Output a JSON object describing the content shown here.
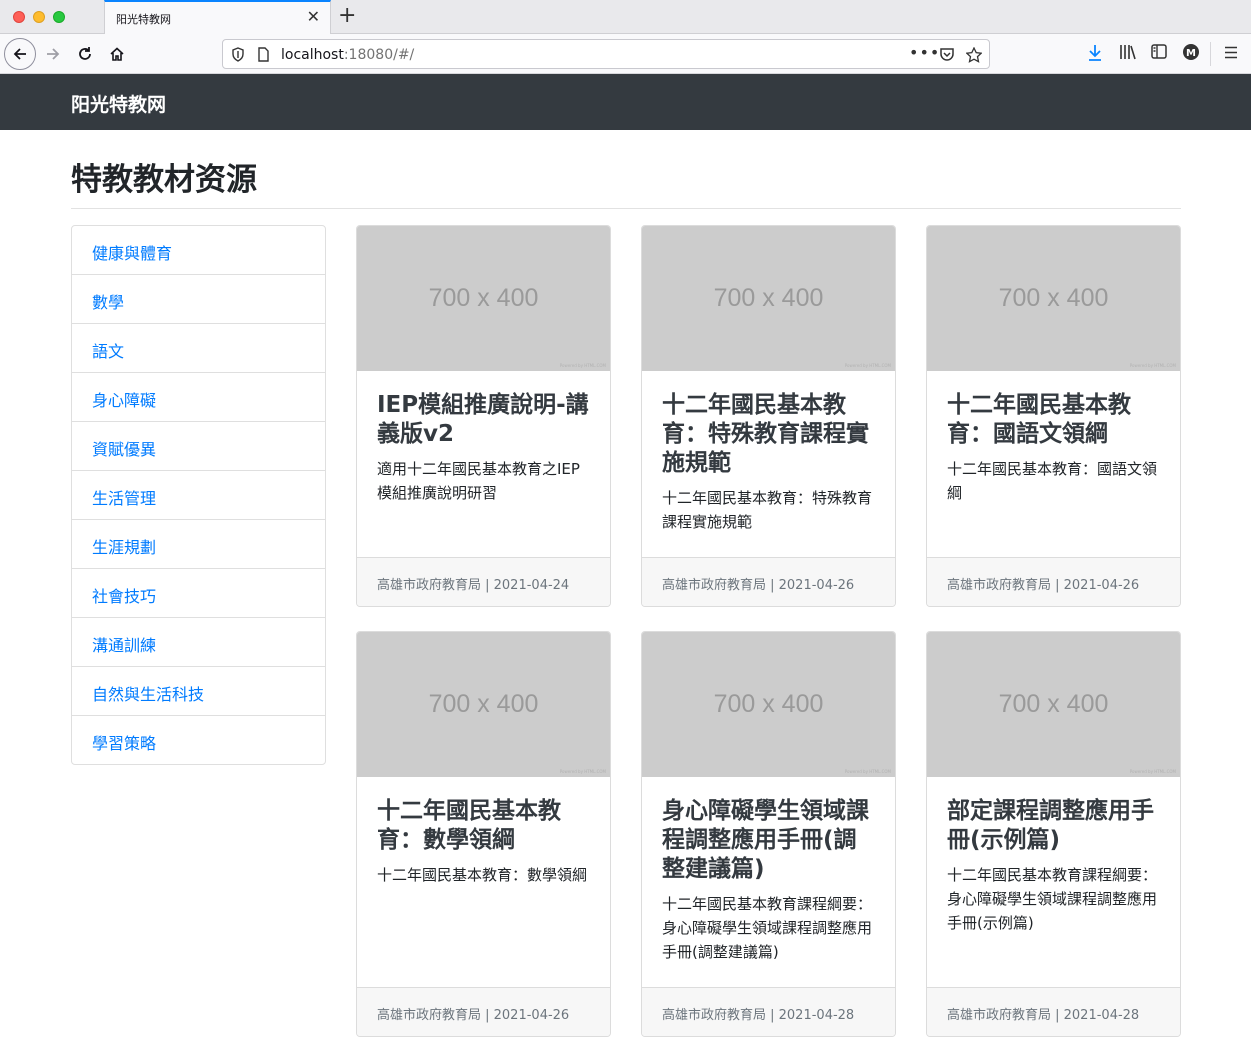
{
  "browser": {
    "tab_title": "阳光特教网",
    "url_host": "localhost",
    "url_rest": ":18080/#/"
  },
  "site": {
    "brand": "阳光特教网",
    "page_title": "特教教材资源"
  },
  "sidebar": {
    "items": [
      {
        "label": "健康與體育"
      },
      {
        "label": "數學"
      },
      {
        "label": "語文"
      },
      {
        "label": "身心障礙"
      },
      {
        "label": "資賦優異"
      },
      {
        "label": "生活管理"
      },
      {
        "label": "生涯規劃"
      },
      {
        "label": "社會技巧"
      },
      {
        "label": "溝通訓練"
      },
      {
        "label": "自然與生活科技"
      },
      {
        "label": "學習策略"
      }
    ]
  },
  "cards": [
    {
      "img": "700 x 400",
      "img_note": "Powered by HTML.COM",
      "title": "IEP模組推廣說明-講義版v2",
      "text": "適用十二年國民基本教育之IEP模組推廣說明研習",
      "footer": "高雄市政府教育局 | 2021-04-24"
    },
    {
      "img": "700 x 400",
      "img_note": "Powered by HTML.COM",
      "title": "十二年國民基本教育：特殊教育課程實施規範",
      "text": "十二年國民基本教育：特殊教育課程實施規範",
      "footer": "高雄市政府教育局 | 2021-04-26"
    },
    {
      "img": "700 x 400",
      "img_note": "Powered by HTML.COM",
      "title": "十二年國民基本教育：國語文領綱",
      "text": "十二年國民基本教育：國語文領綱",
      "footer": "高雄市政府教育局 | 2021-04-26"
    },
    {
      "img": "700 x 400",
      "img_note": "Powered by HTML.COM",
      "title": "十二年國民基本教育：數學領綱",
      "text": "十二年國民基本教育：數學領綱",
      "footer": "高雄市政府教育局 | 2021-04-26"
    },
    {
      "img": "700 x 400",
      "img_note": "Powered by HTML.COM",
      "title": "身心障礙學生領域課程調整應用手冊(調整建議篇)",
      "text": "十二年國民基本教育課程綱要：身心障礙學生領域課程調整應用手冊(調整建議篇)",
      "footer": "高雄市政府教育局 | 2021-04-28"
    },
    {
      "img": "700 x 400",
      "img_note": "Powered by HTML.COM",
      "title": "部定課程調整應用手冊(示例篇)",
      "text": "十二年國民基本教育課程綱要：身心障礙學生領域課程調整應用手冊(示例篇)",
      "footer": "高雄市政府教育局 | 2021-04-28"
    }
  ]
}
